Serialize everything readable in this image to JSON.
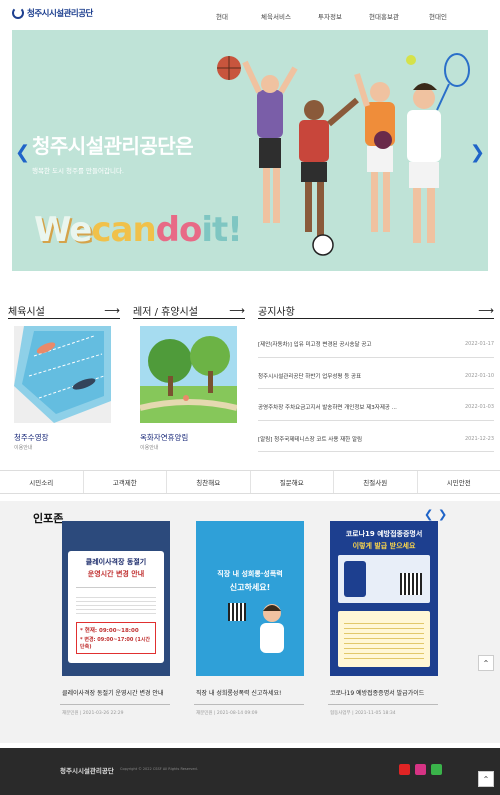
{
  "header": {
    "logo_text": "청주시시설관리공단",
    "nav": [
      "현대",
      "체육서비스",
      "투자정보",
      "현대홍보관",
      "현대인"
    ]
  },
  "hero": {
    "title": "청주시설관리공단은",
    "subtitle": "행복한 도시 청주를 만들어갑니다.",
    "brand": [
      "We",
      "can",
      "do",
      "it!"
    ],
    "colors": {
      "bg": "#bfe3d7",
      "arrow": "#1f64c8"
    }
  },
  "sections": {
    "sports": {
      "title": "체육시설",
      "card_title": "청주수영장",
      "card_sub": "이용안내"
    },
    "leisure": {
      "title": "레저 / 휴양시설",
      "card_title": "옥화자연휴양림",
      "card_sub": "이용안내"
    },
    "notice": {
      "title": "공지사항",
      "items": [
        {
          "text": "[제안(자동차)] 입유 미고정 변경된 공시송달 공고",
          "date": "2022-01-17"
        },
        {
          "text": "청주시시설관리공단 하반기 업무성평 등 공표",
          "date": "2022-01-10"
        },
        {
          "text": "공영주차장 주차요금고지서 발송하면 개인정보 제3자제공 ...",
          "date": "2022-01-03"
        },
        {
          "text": "[알림] 청주국제테니스장 코트 사용 재한 알림",
          "date": "2021-12-23"
        }
      ]
    }
  },
  "quick_links": [
    "시민소리",
    "고객제한",
    "칭찬해요",
    "질문해요",
    "친절사원",
    "시민안전"
  ],
  "info": {
    "title": "인포존",
    "posters": [
      {
        "caption": "클레이사격장 동절기 운영시간 변경 안내",
        "meta": "재분민원 | 2021-03-26 22:29",
        "head1": "클레이사격장 동절기",
        "head2": "운영시간 변경 안내",
        "note1": "* 현재: 09:00~18:00",
        "note2": "* 변경: 09:00~17:00 (1시간 단축)"
      },
      {
        "caption": "직장 내 성희롱성폭력 신고하세요!",
        "meta": "재분민원 | 2021-08-14 09:09",
        "head1": "직장 내 성희롱·성폭력",
        "head2": "신고하세요!"
      },
      {
        "caption": "코로나19 예방접종증명서 발급가이드",
        "meta": "협동사업부 | 2021-11-05 18:34",
        "head1": "코로나19 예방접종증명서",
        "head2": "이렇게 발급 받으세요"
      }
    ]
  },
  "footer": {
    "logo_text": "청주시시설관리공단",
    "copyright": "Copyright © 2022 CSSF All Rights Reserved."
  }
}
